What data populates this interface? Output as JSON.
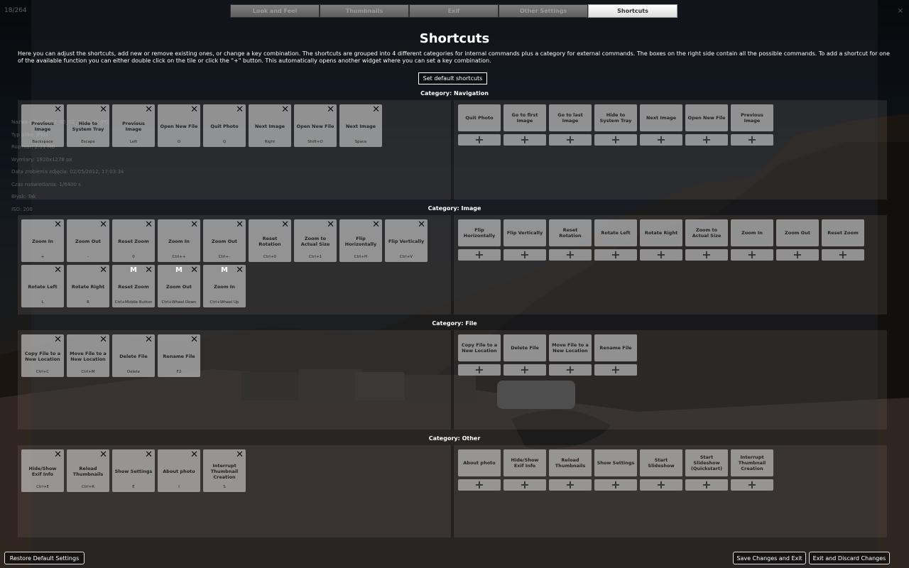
{
  "counter": "18/264",
  "close": "×",
  "ghost_info": [
    "Nazwa pliku: 2012_05_02_1250_01.JPG",
    "Typ pliku: JPEG",
    "Rozmiar: 2.11 MB",
    "Wymiary: 1920x1278 px",
    "",
    "Data zrobienia zdjęcia: 02/05/2012, 17:03:34",
    "",
    "Czas naświetlania: 1/6400 s",
    "Błysk: Tak",
    "ISO: 200"
  ],
  "tabs": [
    {
      "label": "Look and Feel"
    },
    {
      "label": "Thumbnails"
    },
    {
      "label": "Exif"
    },
    {
      "label": "Other Settings"
    },
    {
      "label": "Shortcuts"
    }
  ],
  "page": {
    "title": "Shortcuts",
    "intro": "Here you can adjust the shortcuts, add new or remove existing ones, or change a key combination. The shortcuts are grouped into 4 different categories for internal commands plus a category for external commands. The boxes on the right side contain all the possible commands. To add a shortcut for one of the available function you can either double click on the tile or click the \"+\" button. This automatically opens another widget where you can set a key combination.",
    "set_default_label": "Set default shortcuts"
  },
  "icons": {
    "close": "close-icon",
    "plus": "plus-icon"
  },
  "categories": [
    {
      "title": "Category: Navigation",
      "assigned": [
        {
          "name": "Previous Image",
          "key": "Backspace"
        },
        {
          "name": "Hide to System Tray",
          "key": "Escape"
        },
        {
          "name": "Previous Image",
          "key": "Left"
        },
        {
          "name": "Open New File",
          "key": "O"
        },
        {
          "name": "Quit Photo",
          "key": "Q"
        },
        {
          "name": "Next Image",
          "key": "Right"
        },
        {
          "name": "Open New File",
          "key": "Shift+O"
        },
        {
          "name": "Next Image",
          "key": "Space"
        }
      ],
      "available": [
        "Quit Photo",
        "Go to first Image",
        "Go to last Image",
        "Hide to System Tray",
        "Next Image",
        "Open New File",
        "Previous Image"
      ]
    },
    {
      "title": "Category: Image",
      "assigned": [
        {
          "name": "Zoom In",
          "key": "+"
        },
        {
          "name": "Zoom Out",
          "key": "-"
        },
        {
          "name": "Reset Zoom",
          "key": "0"
        },
        {
          "name": "Zoom In",
          "key": "Ctrl++"
        },
        {
          "name": "Zoom Out",
          "key": "Ctrl+-"
        },
        {
          "name": "Reset Rotation",
          "key": "Ctrl+0"
        },
        {
          "name": "Zoom to Actual Size",
          "key": "Ctrl+1"
        },
        {
          "name": "Flip Horizontally",
          "key": "Ctrl+H"
        },
        {
          "name": "Flip Vertically",
          "key": "Ctrl+V"
        },
        {
          "name": "Rotate Left",
          "key": "L"
        },
        {
          "name": "Rotate Right",
          "key": "R"
        },
        {
          "name": "Reset Zoom",
          "key": "Ctrl+Middle Button",
          "mouse": "M"
        },
        {
          "name": "Zoom Out",
          "key": "Ctrl+Wheel Down",
          "mouse": "M"
        },
        {
          "name": "Zoom In",
          "key": "Ctrl+Wheel Up",
          "mouse": "M"
        }
      ],
      "available": [
        "Flip Horizontally",
        "Flip Vertically",
        "Reset Rotation",
        "Rotate Left",
        "Rotate Right",
        "Zoom to Actual Size",
        "Zoom In",
        "Zoom Out",
        "Reset Zoom"
      ]
    },
    {
      "title": "Category: File",
      "assigned": [
        {
          "name": "Copy File to a New Location",
          "key": "Ctrl+C"
        },
        {
          "name": "Move File to a New Location",
          "key": "Ctrl+M"
        },
        {
          "name": "Delete File",
          "key": "Delete"
        },
        {
          "name": "Rename File",
          "key": "F2"
        }
      ],
      "available": [
        "Copy File to a New Location",
        "Delete File",
        "Move File to a New Location",
        "Rename File"
      ]
    },
    {
      "title": "Category: Other",
      "assigned": [
        {
          "name": "Hide/Show Exif Info",
          "key": "Ctrl+E"
        },
        {
          "name": "Reload Thumbnails",
          "key": "Ctrl+R"
        },
        {
          "name": "Show Settings",
          "key": "E"
        },
        {
          "name": "About photo",
          "key": "I"
        },
        {
          "name": "Interrupt Thumbnail Creation",
          "key": "S"
        }
      ],
      "available": [
        "About photo",
        "Hide/Show Exif Info",
        "Reload Thumbnails",
        "Show Settings",
        "Start Slideshow",
        "Start Slideshow (Quickstart)",
        "Interrupt Thumbnail Creation"
      ]
    }
  ],
  "buttons": {
    "restore": "Restore Default Settings",
    "save": "Save Changes and Exit",
    "discard": "Exit and Discard Changes"
  }
}
